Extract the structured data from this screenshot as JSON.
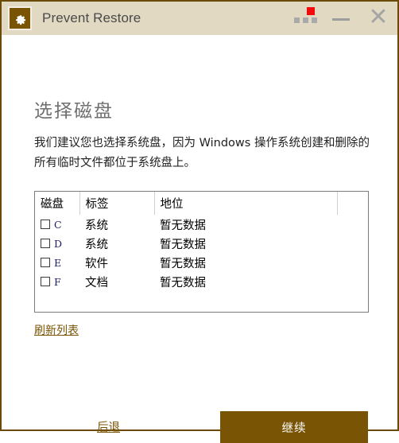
{
  "window": {
    "border_color": "#6b4a05",
    "titlebar_bg": "#e2d9c3",
    "accent_color": "#7a5405"
  },
  "titlebar": {
    "app_title": "Prevent Restore",
    "icon_name": "gear-icon",
    "controls": {
      "menu_label": "•••",
      "badge_color": "#f30b0b",
      "minimize_label": "—",
      "close_label": "✕"
    }
  },
  "main": {
    "page_title": "选择磁盘",
    "description": "我们建议您也选择系统盘，因为 Windows 操作系统创建和删除的所有临时文件都位于系统盘上。",
    "table": {
      "headers": {
        "disk": "磁盘",
        "label": "标签",
        "status": "地位",
        "extra": ""
      },
      "rows": [
        {
          "checked": false,
          "drive": "C",
          "label": "系统",
          "status": "暂无数据"
        },
        {
          "checked": false,
          "drive": "D",
          "label": "系统",
          "status": "暂无数据"
        },
        {
          "checked": false,
          "drive": "E",
          "label": "软件",
          "status": "暂无数据"
        },
        {
          "checked": false,
          "drive": "F",
          "label": "文档",
          "status": "暂无数据"
        }
      ]
    },
    "refresh_link": "刷新列表"
  },
  "footer": {
    "back_label": "后退",
    "continue_label": "继续"
  }
}
